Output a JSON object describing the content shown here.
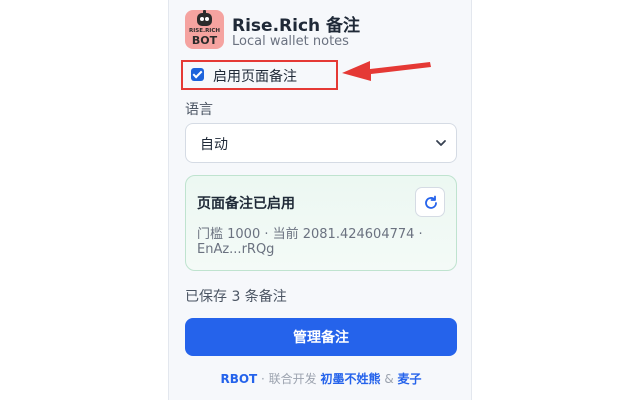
{
  "app": {
    "title": "Rise.Rich 备注",
    "subtitle": "Local wallet notes",
    "logo_top": "RISE.RICH",
    "logo_bottom": "BOT"
  },
  "toggle": {
    "label": "启用页面备注",
    "checked": true
  },
  "language": {
    "label": "语言",
    "selected": "自动"
  },
  "status": {
    "title": "页面备注已启用",
    "line1": "门槛 1000 · 当前 2081.424604774 ·",
    "line2": "EnAz...rRQg"
  },
  "saved_text": "已保存 3 条备注",
  "manage_button": "管理备注",
  "footer": {
    "rbot": "RBOT",
    "sep1": " · 联合开发 ",
    "dev1": "初墨不姓熊",
    "sep2": " & ",
    "dev2": "麦子"
  },
  "colors": {
    "accent": "#2563eb",
    "highlight_border": "#e53935",
    "card_bg": "#ecf8f2"
  }
}
